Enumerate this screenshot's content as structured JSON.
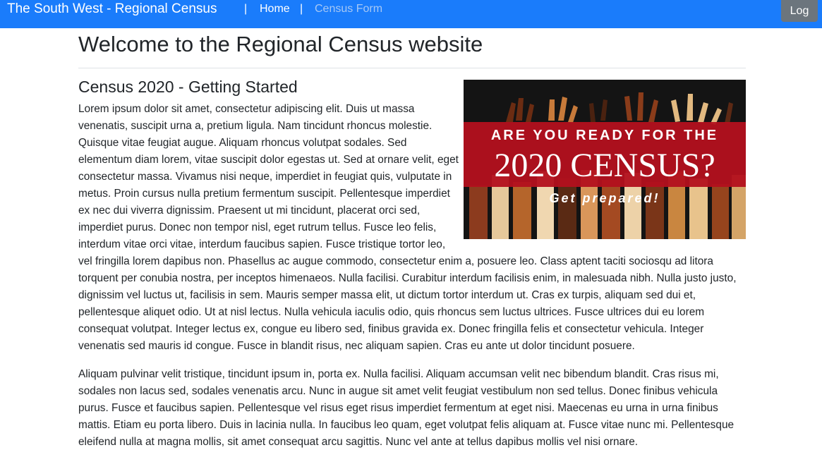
{
  "navbar": {
    "brand": "The South West - Regional Census",
    "separator": "|",
    "links": [
      {
        "label": "Home"
      },
      {
        "label": "Census Form"
      }
    ],
    "log_button": "Log"
  },
  "main": {
    "page_title": "Welcome to the Regional Census website",
    "section_title": "Census 2020 - Getting Started",
    "banner": {
      "line1": "ARE YOU READY FOR THE",
      "line2": "2020 CENSUS?",
      "line3": "Get prepared!"
    },
    "paragraphs": [
      "Lorem ipsum dolor sit amet, consectetur adipiscing elit. Duis ut massa venenatis, suscipit urna a, pretium ligula. Nam tincidunt rhoncus molestie. Quisque vitae feugiat augue. Aliquam rhoncus volutpat sodales. Sed elementum diam lorem, vitae suscipit dolor egestas ut. Sed at ornare velit, eget consectetur massa. Vivamus nisi neque, imperdiet in feugiat quis, vulputate in metus. Proin cursus nulla pretium fermentum suscipit. Pellentesque imperdiet ex nec dui viverra dignissim. Praesent ut mi tincidunt, placerat orci sed, imperdiet purus. Donec non tempor nisl, eget rutrum tellus. Fusce leo felis, interdum vitae orci vitae, interdum faucibus sapien. Fusce tristique tortor leo, vel fringilla lorem dapibus non. Phasellus ac augue commodo, consectetur enim a, posuere leo. Class aptent taciti sociosqu ad litora torquent per conubia nostra, per inceptos himenaeos. Nulla facilisi. Curabitur interdum facilisis enim, in malesuada nibh. Nulla justo justo, dignissim vel luctus ut, facilisis in sem. Mauris semper massa elit, ut dictum tortor interdum ut. Cras ex turpis, aliquam sed dui et, pellentesque aliquet odio. Ut at nisl lectus. Nulla vehicula iaculis odio, quis rhoncus sem luctus ultrices. Fusce ultrices dui eu lorem consequat volutpat. Integer lectus ex, congue eu libero sed, finibus gravida ex. Donec fringilla felis et consectetur vehicula. Integer venenatis sed mauris id congue. Fusce in blandit risus, nec aliquam sapien. Cras eu ante ut dolor tincidunt posuere.",
      "Aliquam pulvinar velit tristique, tincidunt ipsum in, porta ex. Nulla facilisi. Aliquam accumsan velit nec bibendum blandit. Cras risus mi, sodales non lacus sed, sodales venenatis arcu. Nunc in augue sit amet velit feugiat vestibulum non sed tellus. Donec finibus vehicula purus. Fusce et faucibus sapien. Pellentesque vel risus eget risus imperdiet fermentum at eget nisi. Maecenas eu urna in urna finibus mattis. Etiam eu porta libero. Duis in lacinia nulla. In faucibus leo quam, eget volutpat felis aliquam at. Fusce vitae nunc mi. Pellentesque eleifend nulla at magna mollis, sit amet consequat arcu sagittis. Nunc vel ante at tellus dapibus mollis vel nisi ornare."
    ]
  },
  "colors": {
    "navbar_bg": "#1a7cfb",
    "muted_link": "#a6c8f5",
    "log_button_bg": "#6c757d",
    "banner_red": "#b3101e"
  }
}
